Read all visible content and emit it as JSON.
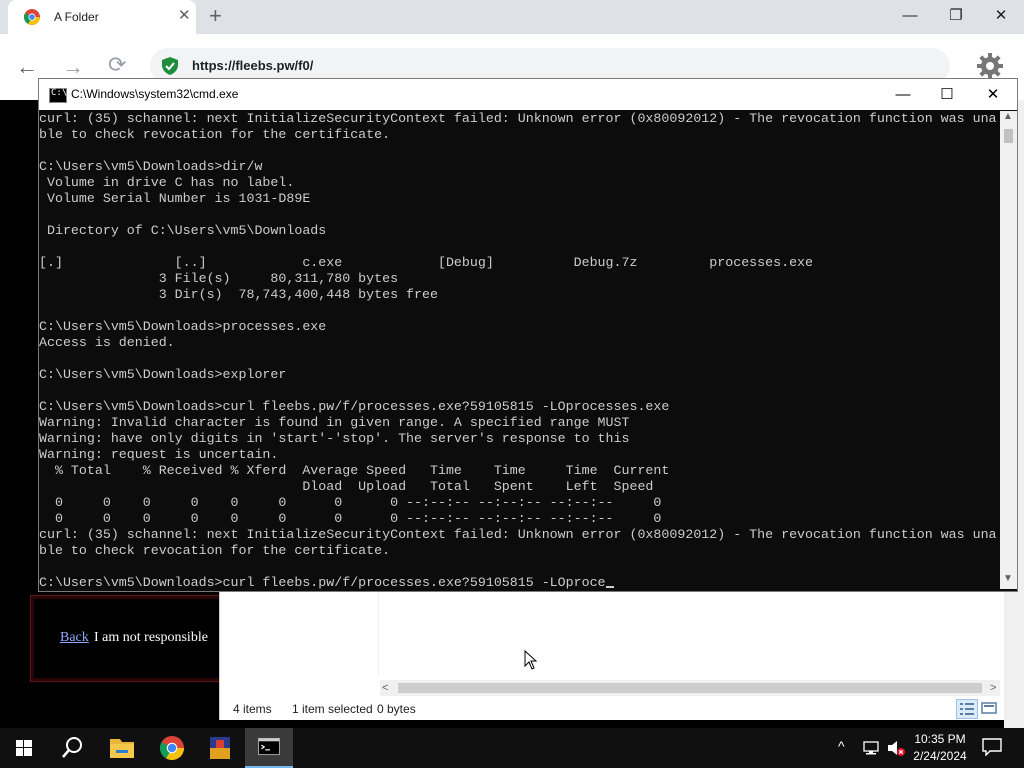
{
  "browser": {
    "tab_title": "A Folder",
    "tab_close": "✕",
    "new_tab": "+",
    "url": "https://fleebs.pw/f0/",
    "nav": {
      "back": "←",
      "forward": "→",
      "reload": "⟳"
    },
    "window_controls": {
      "minimize": "—",
      "maximize": "❐",
      "close": "✕"
    }
  },
  "page": {
    "back_link": "Back",
    "disclaimer": "I am not responsible"
  },
  "cmd": {
    "title": "C:\\Windows\\system32\\cmd.exe",
    "icon_glyph": "C:\\",
    "window_controls": {
      "minimize": "—",
      "maximize": "☐",
      "close": "✕"
    },
    "lines": [
      "curl: (35) schannel: next InitializeSecurityContext failed: Unknown error (0x80092012) - The revocation function was una",
      "ble to check revocation for the certificate.",
      "",
      "C:\\Users\\vm5\\Downloads>dir/w",
      " Volume in drive C has no label.",
      " Volume Serial Number is 1031-D89E",
      "",
      " Directory of C:\\Users\\vm5\\Downloads",
      "",
      "[.]              [..]            c.exe            [Debug]          Debug.7z         processes.exe",
      "               3 File(s)     80,311,780 bytes",
      "               3 Dir(s)  78,743,400,448 bytes free",
      "",
      "C:\\Users\\vm5\\Downloads>processes.exe",
      "Access is denied.",
      "",
      "C:\\Users\\vm5\\Downloads>explorer",
      "",
      "C:\\Users\\vm5\\Downloads>curl fleebs.pw/f/processes.exe?59105815 -LOprocesses.exe",
      "Warning: Invalid character is found in given range. A specified range MUST",
      "Warning: have only digits in 'start'-'stop'. The server's response to this",
      "Warning: request is uncertain.",
      "  % Total    % Received % Xferd  Average Speed   Time    Time     Time  Current",
      "                                 Dload  Upload   Total   Spent    Left  Speed",
      "  0     0    0     0    0     0      0      0 --:--:-- --:--:-- --:--:--     0",
      "  0     0    0     0    0     0      0      0 --:--:-- --:--:-- --:--:--     0",
      "curl: (35) schannel: next InitializeSecurityContext failed: Unknown error (0x80092012) - The revocation function was una",
      "ble to check revocation for the certificate.",
      ""
    ],
    "prompt_line": "C:\\Users\\vm5\\Downloads>curl fleebs.pw/f/processes.exe?59105815 -LOproce",
    "scroll": {
      "up": "▲",
      "down": "▼"
    }
  },
  "explorer": {
    "item_count": "4 items",
    "selected": "1 item selected",
    "size": "0 bytes",
    "scroll": {
      "left": "<",
      "right": ">"
    }
  },
  "taskbar": {
    "tray_chevron": "^",
    "time": "10:35 PM",
    "date": "2/24/2024"
  },
  "colors": {
    "terminal_bg": "#0c0c0c",
    "terminal_text": "#cccccc",
    "taskbar_bg": "#101010",
    "link": "#8fa8ff"
  }
}
